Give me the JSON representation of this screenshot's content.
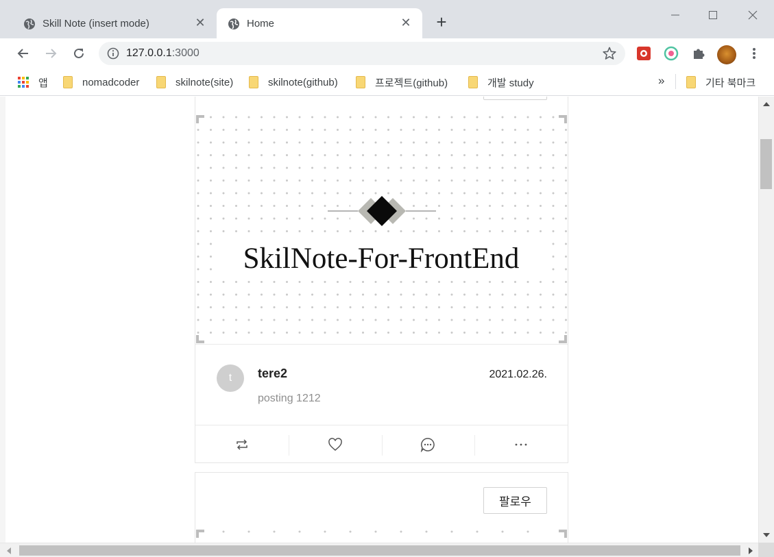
{
  "tabs": [
    {
      "title": "Skill Note (insert mode)",
      "active": false
    },
    {
      "title": "Home",
      "active": true
    }
  ],
  "address_bar": {
    "host": "127.0.0.1",
    "port": ":3000"
  },
  "bookmarks": {
    "apps_label": "앱",
    "items": [
      "nomadcoder",
      "skilnote(site)",
      "skilnote(github)",
      "프로젝트(github)",
      "개발 study"
    ],
    "overflow": "»",
    "other_label": "기타 북마크"
  },
  "post": {
    "banner_title": "SkilNote-For-FrontEnd",
    "avatar_letter": "t",
    "username": "tere2",
    "date": "2021.02.26.",
    "text": "posting 1212"
  },
  "next_post": {
    "follow_label": "팔로우"
  },
  "colors": {
    "tabstrip": "#dee1e6",
    "omnibox": "#f1f3f4",
    "folder": "#f8d775",
    "avatar_placeholder": "#cfcfcf",
    "muted_text": "#8e8e8e"
  },
  "icons": [
    "globe-icon",
    "close-icon",
    "plus-icon",
    "back-icon",
    "forward-icon",
    "reload-icon",
    "info-icon",
    "star-icon",
    "extension-icon",
    "puzzle-icon",
    "apps-icon",
    "folder-icon",
    "repost-icon",
    "heart-icon",
    "comment-icon",
    "more-icon"
  ]
}
